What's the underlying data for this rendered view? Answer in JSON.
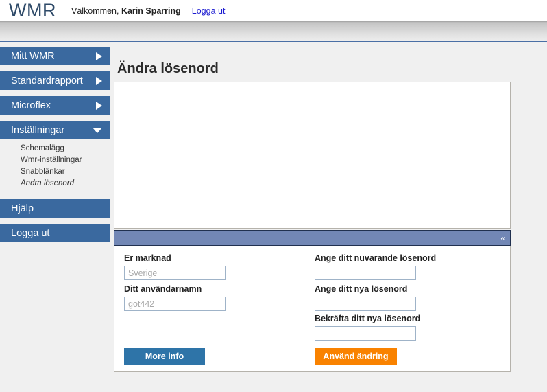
{
  "header": {
    "brand": "WMR",
    "welcome_prefix": "Välkommen, ",
    "user_name": "Karin Sparring",
    "logout_link": "Logga ut"
  },
  "sidebar": {
    "items": [
      {
        "label": "Mitt WMR",
        "icon": "chevron-right-icon",
        "expanded": false
      },
      {
        "label": "Standardrapport",
        "icon": "chevron-right-icon",
        "expanded": false
      },
      {
        "label": "Microflex",
        "icon": "chevron-right-icon",
        "expanded": false
      },
      {
        "label": "Inställningar",
        "icon": "chevron-down-icon",
        "expanded": true
      },
      {
        "label": "Hjälp",
        "icon": "none",
        "expanded": false
      },
      {
        "label": "Logga ut",
        "icon": "none",
        "expanded": false
      }
    ],
    "submenu": [
      {
        "label": "Schemalägg",
        "active": false
      },
      {
        "label": "Wmr-inställningar",
        "active": false
      },
      {
        "label": "Snabblänkar",
        "active": false
      },
      {
        "label": "Andra lösenord",
        "active": true
      }
    ]
  },
  "main": {
    "page_title": "Ändra lösenord",
    "collapse_bar": {
      "chevron": "«"
    },
    "form": {
      "market_label": "Er marknad",
      "market_placeholder": "Sverige",
      "market_value": "",
      "username_label": "Ditt användarnamn",
      "username_placeholder": "got442",
      "username_value": "",
      "current_password_label": "Ange ditt nuvarande lösenord",
      "current_password_value": "",
      "new_password_label": "Ange ditt nya lösenord",
      "new_password_value": "",
      "confirm_password_label": "Bekräfta ditt nya lösenord",
      "confirm_password_value": ""
    },
    "buttons": {
      "more_info": "More info",
      "apply": "Använd ändring"
    }
  },
  "colors": {
    "sidebar_blue": "#3a699f",
    "collapse_bar_blue": "#7287b5",
    "button_blue": "#2e74a8",
    "button_orange": "#f98200",
    "link_blue": "#1a1ad0",
    "brand_navy": "#2e4a68"
  }
}
